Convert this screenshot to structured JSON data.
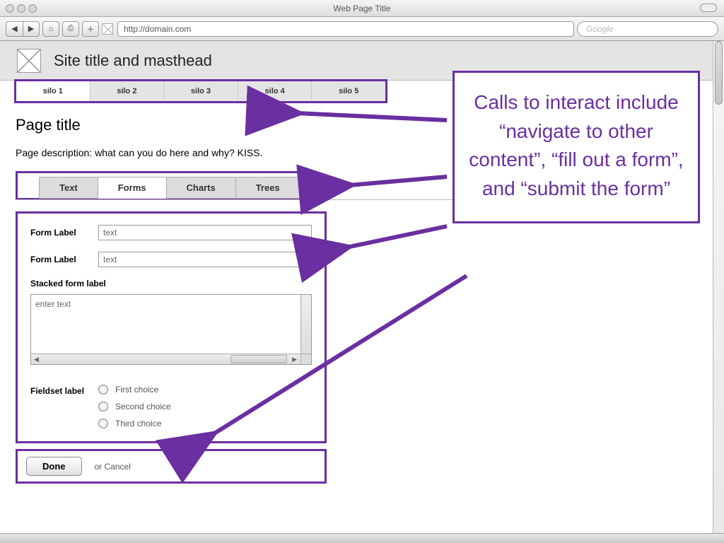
{
  "browser": {
    "window_title": "Web Page Title",
    "url": "http://domain.com",
    "search_placeholder": "Google"
  },
  "masthead": {
    "site_title": "Site title and masthead"
  },
  "silos": {
    "items": [
      {
        "label": "silo 1",
        "active": true
      },
      {
        "label": "silo 2",
        "active": false
      },
      {
        "label": "silo 3",
        "active": false
      },
      {
        "label": "silo 4",
        "active": false
      },
      {
        "label": "silo 5",
        "active": false
      }
    ]
  },
  "page": {
    "title": "Page title",
    "description": "Page description: what can you do here and why? KISS."
  },
  "tabs": {
    "items": [
      {
        "label": "Text",
        "active": false
      },
      {
        "label": "Forms",
        "active": true
      },
      {
        "label": "Charts",
        "active": false
      },
      {
        "label": "Trees",
        "active": false
      }
    ]
  },
  "form": {
    "row1_label": "Form Label",
    "row1_value": "text",
    "row2_label": "Form Label",
    "row2_value": "text",
    "stacked_label": "Stacked form label",
    "textarea_placeholder": "enter text",
    "fieldset_label": "Fieldset label",
    "choices": [
      "First choice",
      "Second choice",
      "Third choice"
    ]
  },
  "actions": {
    "done": "Done",
    "cancel": "or Cancel"
  },
  "annotation": {
    "text": "Calls to interact include “navigate to other content”, “fill out a form”, and “submit the form”"
  },
  "colors": {
    "highlight": "#6a2fa0"
  }
}
